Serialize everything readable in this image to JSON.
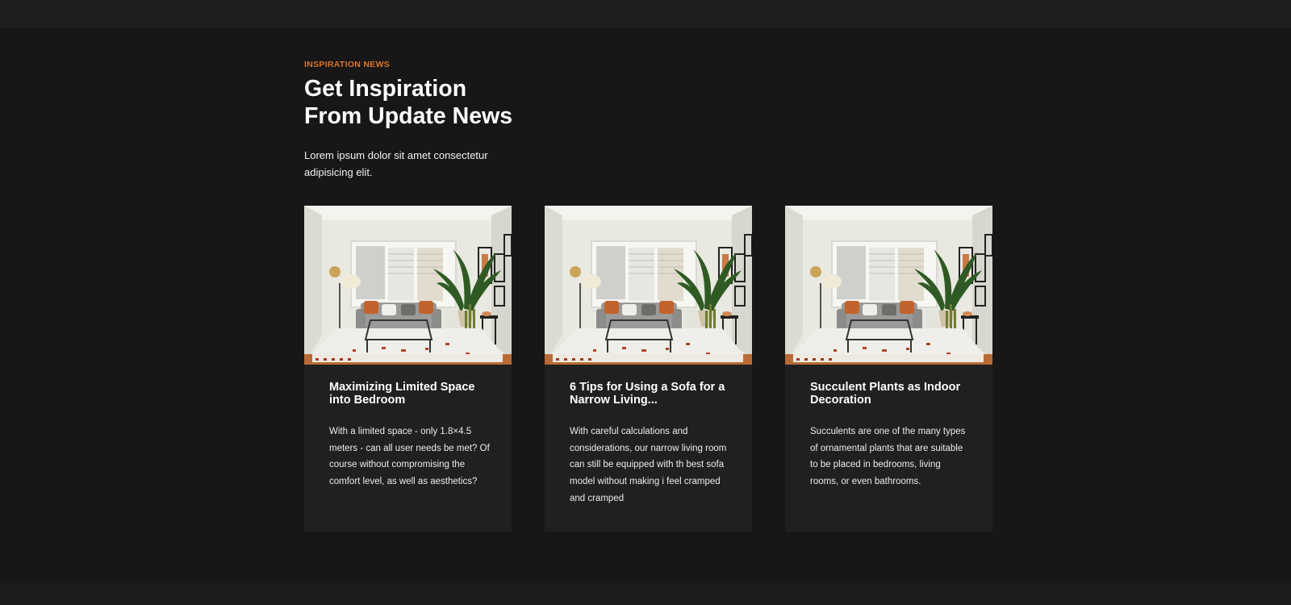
{
  "section": {
    "eyebrow": "INSPIRATION NEWS",
    "heading_line1": "Get Inspiration",
    "heading_line2": "From Update News",
    "intro": "Lorem ipsum dolor sit amet consectetur adipisicing elit."
  },
  "posts": [
    {
      "title": "Maximizing Limited Space into Bedroom",
      "excerpt": "With a limited space - only 1.8×4.5 meters - can all user needs be met? Of course without compromising the comfort level, as well as aesthetics?",
      "image": "living-room-photo"
    },
    {
      "title": "6 Tips for Using a Sofa for a Narrow Living...",
      "excerpt": "With careful calculations and considerations, our narrow living room can still be equipped with th best sofa model without making i feel cramped and cramped",
      "image": "living-room-photo"
    },
    {
      "title": "Succulent Plants as Indoor Decoration",
      "excerpt": "Succulents are one of the many types of ornamental plants that are suitable to be placed in bedrooms, living rooms, or even bathrooms.",
      "image": "living-room-photo"
    }
  ],
  "colors": {
    "background": "#171717",
    "band": "#1e1e1e",
    "card": "#202020",
    "accent": "#d9742b",
    "text": "#ffffff"
  }
}
